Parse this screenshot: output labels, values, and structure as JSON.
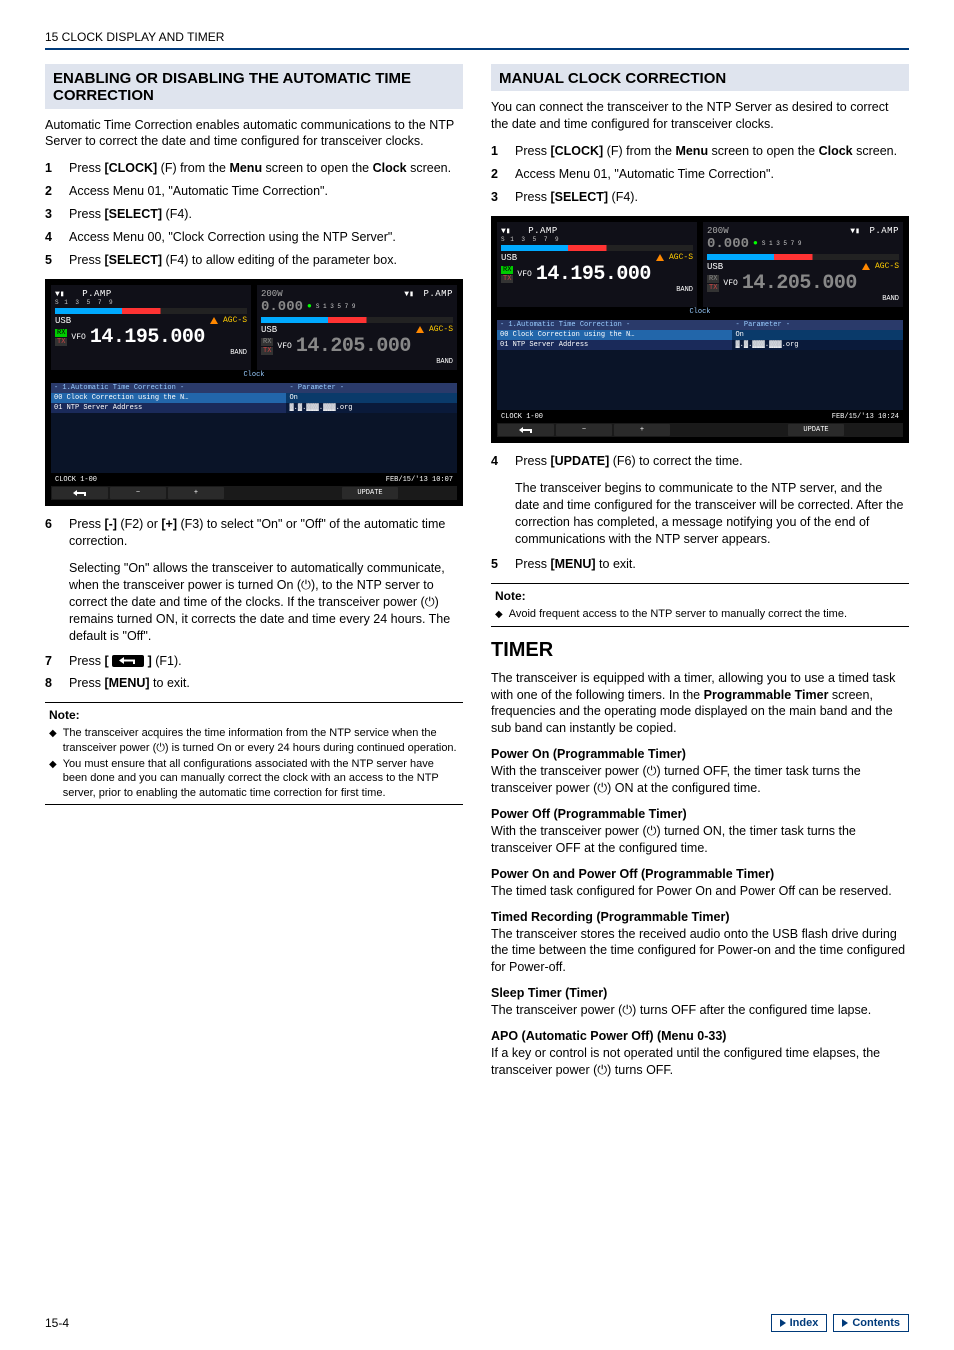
{
  "chapter": "15 CLOCK DISPLAY AND TIMER",
  "page_num": "15-4",
  "footer": {
    "index": "Index",
    "contents": "Contents"
  },
  "left": {
    "h2": "ENABLING OR DISABLING THE AUTOMATIC TIME CORRECTION",
    "intro": "Automatic Time Correction enables automatic communications to the NTP Server to correct the date and time configured for transceiver clocks.",
    "steps": {
      "s1a": "Press ",
      "s1b": "[CLOCK]",
      "s1c": " (F) from the ",
      "s1d": "Menu",
      "s1e": " screen to open the ",
      "s1f": "Clock",
      "s1g": " screen.",
      "s2": "Access Menu 01, \"Automatic Time Correction\".",
      "s3a": "Press ",
      "s3b": "[SELECT]",
      "s3c": " (F4).",
      "s4": "Access Menu 00, \"Clock Correction using the NTP Server\".",
      "s5a": "Press ",
      "s5b": "[SELECT]",
      "s5c": " (F4) to allow editing of the parameter box.",
      "s6a": "Press ",
      "s6b": "[-]",
      "s6c": " (F2) or ",
      "s6d": "[+]",
      "s6e": " (F3) to select \"On\" or \"Off\" of the automatic time correction.",
      "s6sub": "Selecting \"On\" allows the transceiver to automatically communicate, when the transceiver power is turned On (⏻), to the NTP server to correct the date and time of the clocks. If the transceiver power (⏻) remains turned ON, it corrects the date and time every 24 hours. The default is \"Off\".",
      "s7a": "Press ",
      "s7b": "[",
      "s7c": "]",
      "s7d": " (F1).",
      "s8a": "Press ",
      "s8b": "[MENU]",
      "s8c": " to exit."
    },
    "note_label": "Note:",
    "notes": {
      "n1": "The transceiver acquires the time information from the NTP service when the transceiver power (⏻) is turned On or every 24 hours during continued operation.",
      "n2": "You must ensure that all configurations associated with the NTP server have been done and you can manually correct the clock with an access to the NTP server, prior to enabling the automatic time correction for first time."
    },
    "scr": {
      "pamp": "P.AMP",
      "usb": "USB",
      "agc": "AGC-S",
      "vfo": "VFO",
      "freq1": "14.195.000",
      "freq2": "14.205.000",
      "w200": "200W",
      "zero": "0.000",
      "band": "BAND",
      "th1": "- 1.Automatic Time Correction -",
      "th2": "- Parameter -",
      "r1a": "00 Clock Correction using the N…",
      "r1b": "On",
      "r2a": "01 NTP Server Address",
      "r2b": "▓.▓.▓▓▓.▓▓▓.org",
      "bl": "CLOCK 1-00",
      "br": "FEB/15/'13   10:07",
      "fk_minus": "−",
      "fk_plus": "+",
      "fk_update": "UPDATE"
    }
  },
  "right": {
    "h2": "MANUAL CLOCK CORRECTION",
    "intro": "You can connect the transceiver to the NTP Server as desired to correct the date and time configured for transceiver clocks.",
    "steps": {
      "s1a": "Press ",
      "s1b": "[CLOCK]",
      "s1c": " (F) from the ",
      "s1d": "Menu",
      "s1e": " screen to open the ",
      "s1f": "Clock",
      "s1g": " screen.",
      "s2": "Access Menu 01, \"Automatic Time Correction\".",
      "s3a": "Press ",
      "s3b": "[SELECT]",
      "s3c": " (F4).",
      "s4a": "Press ",
      "s4b": "[UPDATE]",
      "s4c": " (F6) to correct the time.",
      "s4sub": "The transceiver begins to communicate to the NTP server, and the date and time configured for the transceiver will be corrected. After the correction has completed, a message notifying you of the end of communications with the NTP server appears.",
      "s5a": "Press ",
      "s5b": "[MENU]",
      "s5c": " to exit."
    },
    "note_label": "Note:",
    "notes": {
      "n1": "Avoid frequent access to the NTP server to manually correct the time."
    },
    "scr": {
      "br": "FEB/15/'13   10:24"
    },
    "timer": {
      "h1": "TIMER",
      "intro_a": "The transceiver is equipped with a timer, allowing you to use a timed task with one of the following timers. In the ",
      "intro_b": "Programmable Timer",
      "intro_c": " screen, frequencies and the operating mode displayed on the main band and the sub band can instantly be copied.",
      "t1h": "Power On (Programmable Timer)",
      "t1": "With the transceiver power (⏻) turned OFF, the timer task turns the transceiver power (⏻) ON at the configured time.",
      "t2h": "Power Off (Programmable Timer)",
      "t2": "With the transceiver power (⏻) turned ON, the timer task turns the transceiver OFF at the configured time.",
      "t3h": "Power On and Power Off (Programmable Timer)",
      "t3": "The timed task configured for Power On and Power Off can be reserved.",
      "t4h": "Timed Recording (Programmable Timer)",
      "t4": "The transceiver stores the received audio onto the USB flash drive during the time between the time configured for Power-on and the time configured for Power-off.",
      "t5h": "Sleep Timer (Timer)",
      "t5": "The transceiver power (⏻) turns OFF after the configured time lapse.",
      "t6h": "APO (Automatic Power Off) (Menu 0-33)",
      "t6": "If a key or control is not operated until the configured time elapses, the transceiver power (⏻) turns OFF."
    }
  }
}
